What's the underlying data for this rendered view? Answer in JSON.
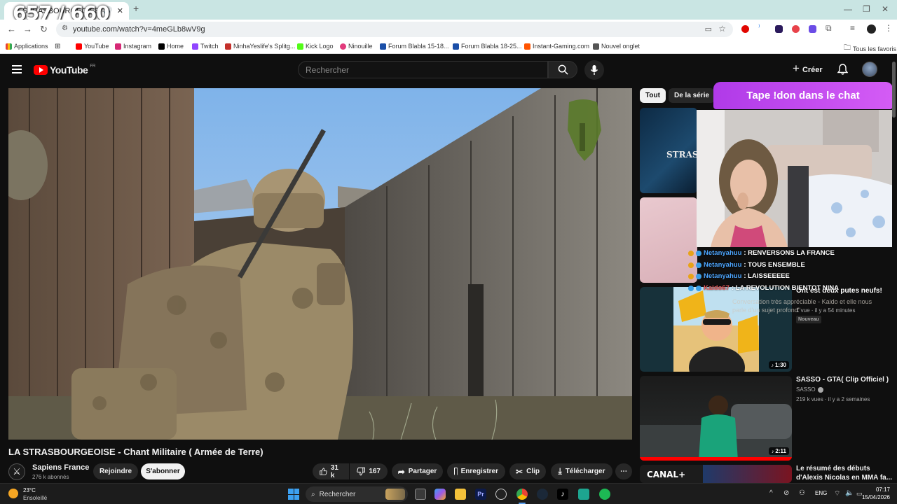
{
  "browser": {
    "tab_title": "STRASBOURGEOISE - Chant Mi",
    "overlay_counter": "657 / 660",
    "url": "youtube.com/watch?v=4meGLb8wV9g"
  },
  "bookmarks": [
    {
      "label": "Applications",
      "color": "#e94235"
    },
    {
      "label": "YouTube",
      "color": "#ff0000"
    },
    {
      "label": "Instagram",
      "color": "#d62976"
    },
    {
      "label": "Home",
      "color": "#000000"
    },
    {
      "label": "Twitch",
      "color": "#9146ff"
    },
    {
      "label": "NinhaYeslife's Splitg...",
      "color": "#c4302b"
    },
    {
      "label": "Kick Logo",
      "color": "#53fc18"
    },
    {
      "label": "Ninouille",
      "color": "#e23b7c"
    },
    {
      "label": "Forum Blabla 15-18...",
      "color": "#1b4fa8"
    },
    {
      "label": "Forum Blabla 18-25...",
      "color": "#1b4fa8"
    },
    {
      "label": "Instant-Gaming.com",
      "color": "#ff5400"
    },
    {
      "label": "Nouvel onglet",
      "color": "#555555"
    }
  ],
  "bookmarks_all": "Tous les favoris",
  "youtube": {
    "logo_text": "YouTube",
    "logo_region": "FR",
    "search_placeholder": "Rechercher",
    "create_label": "Créer"
  },
  "video": {
    "title": "LA STRASBOURGEOISE - Chant Militaire ( Armée de Terre)",
    "channel_name": "Sapiens France",
    "subscribers": "276 k abonnés",
    "join_label": "Rejoindre",
    "subscribe_label": "S'abonner",
    "likes": "31 k",
    "dislikes": "167",
    "share_label": "Partager",
    "save_label": "Enregistrer",
    "clip_label": "Clip",
    "download_label": "Télécharger"
  },
  "sidebar": {
    "chips": [
      "Tout",
      "De la série"
    ],
    "videos": [
      {
        "title": "Ont est deux putes neufs!",
        "channel": "",
        "meta": "1 vue · il y a 54 minutes",
        "badge": "Nouveau",
        "duration": "1:30"
      },
      {
        "title": "SASSO - GTA( Clip Officiel )",
        "channel": "SASSO",
        "meta": "219 k vues · il y a 2 semaines",
        "badge": "",
        "duration": "2:11"
      },
      {
        "title": "Le résumé des débuts",
        "title2": "d'Alexis Nicolas en MMA fa...",
        "channel": "",
        "meta": "",
        "badge": "",
        "duration": ""
      }
    ],
    "thumb1_text": "STRAS"
  },
  "stream_overlay": {
    "donate_text": "Tape !don dans le chat",
    "chat": [
      {
        "user": "Netanyahuu",
        "message": ": RENVERSONS LA FRANCE"
      },
      {
        "user": "Netanyahuu",
        "message": ": TOUS ENSEMBLE"
      },
      {
        "user": "Netanyahuu",
        "message": ": LAISSEEEEE"
      },
      {
        "user": "Kaido67",
        "message": ": LA REVOLUTION BIENTOT NINA"
      }
    ],
    "ghost_text": "Conversation très appréciable - Kaido et elle nous",
    "ghost_text2": "parle d'un sujet profond\""
  },
  "taskbar": {
    "weather_temp": "23°C",
    "weather_desc": "Ensoleillé",
    "search_label": "Rechercher",
    "lang": "ENG",
    "time": "07:17",
    "date": "15/04/2026"
  },
  "colors": {
    "yt_red": "#ff0000",
    "donate_purple": "#c24bf0",
    "chat_user": "#4da6ff"
  }
}
